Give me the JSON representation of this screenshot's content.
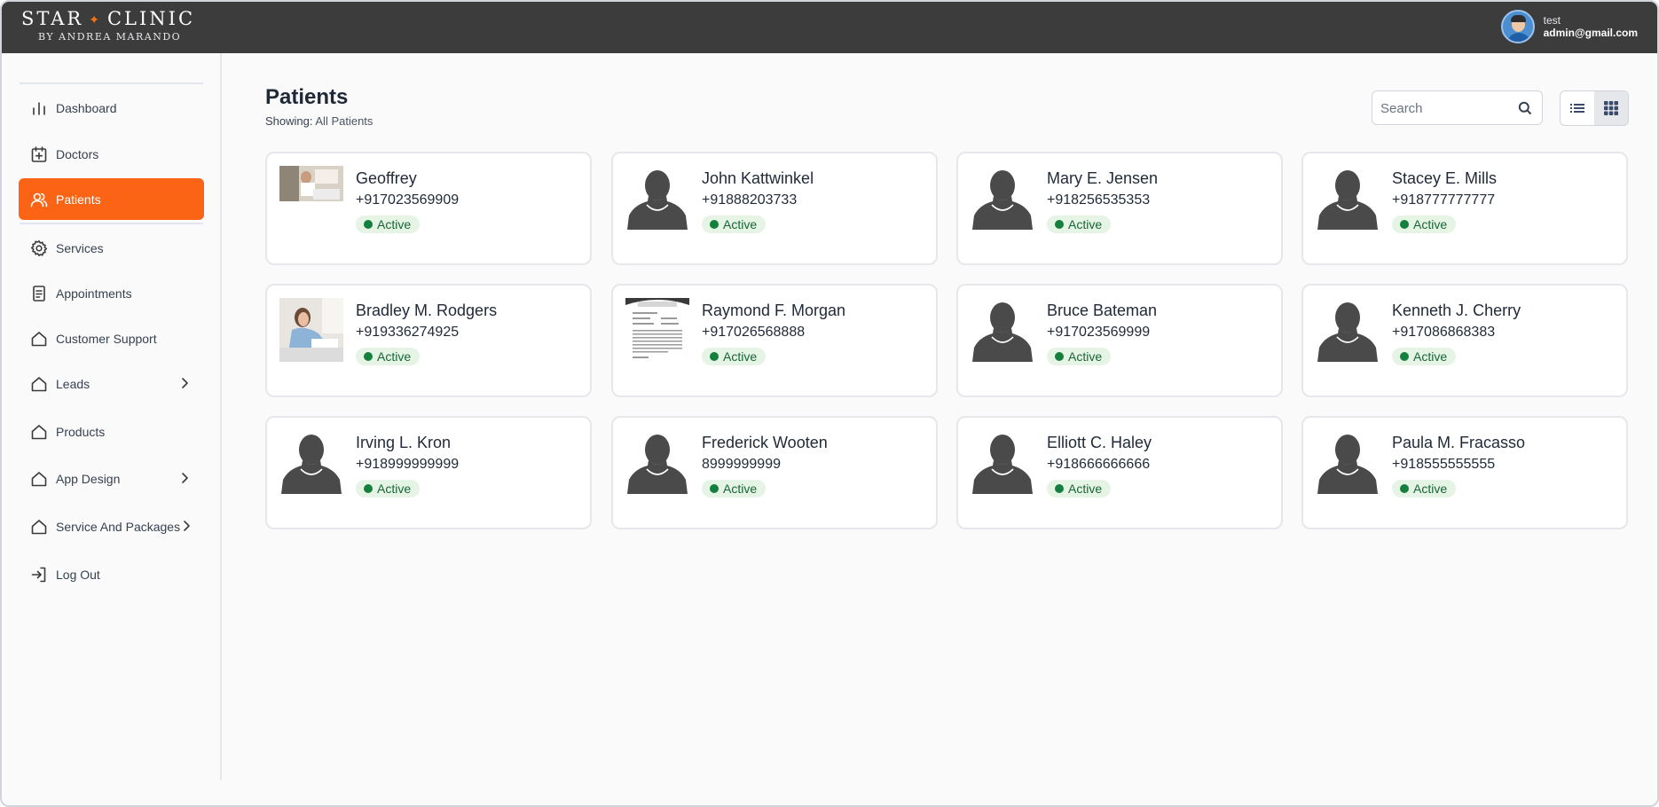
{
  "brand": {
    "name_left": "STAR",
    "name_right": "CLINIC",
    "sub": "BY ANDREA MARANDO",
    "accent": "#fa6414"
  },
  "user": {
    "name": "test",
    "email": "admin@gmail.com"
  },
  "sidebar": {
    "items": [
      {
        "label": "Dashboard",
        "icon": "bar-chart-icon"
      },
      {
        "label": "Doctors",
        "icon": "calendar-plus-icon"
      },
      {
        "label": "Patients",
        "icon": "users-icon",
        "active": true
      },
      {
        "label": "Services",
        "icon": "gear-icon"
      },
      {
        "label": "Appointments",
        "icon": "document-icon"
      },
      {
        "label": "Customer Support",
        "icon": "home-icon"
      },
      {
        "label": "Leads",
        "icon": "home-icon",
        "has_submenu": true
      },
      {
        "label": "Products",
        "icon": "home-icon"
      },
      {
        "label": "App Design",
        "icon": "home-icon",
        "has_submenu": true
      },
      {
        "label": "Service And Packages",
        "icon": "home-icon",
        "has_submenu": true
      },
      {
        "label": "Log Out",
        "icon": "logout-icon"
      }
    ]
  },
  "header": {
    "title": "Patients",
    "showing_label": "Showing:",
    "showing_value": "All Patients"
  },
  "search": {
    "placeholder": "Search",
    "value": ""
  },
  "view": {
    "selected": "grid",
    "options": [
      "list",
      "grid"
    ]
  },
  "patients": [
    {
      "name": "Geoffrey",
      "phone": "+917023569909",
      "status": "Active",
      "photo": "photo-room"
    },
    {
      "name": "John Kattwinkel",
      "phone": "+91888203733",
      "status": "Active",
      "photo": "silhouette"
    },
    {
      "name": "Mary E. Jensen",
      "phone": "+918256535353",
      "status": "Active",
      "photo": "silhouette"
    },
    {
      "name": "Stacey E. Mills",
      "phone": "+918777777777",
      "status": "Active",
      "photo": "silhouette"
    },
    {
      "name": "Bradley M. Rodgers",
      "phone": "+919336274925",
      "status": "Active",
      "photo": "photo-bed"
    },
    {
      "name": "Raymond F. Morgan",
      "phone": "+917026568888",
      "status": "Active",
      "photo": "photo-document"
    },
    {
      "name": "Bruce Bateman",
      "phone": "+917023569999",
      "status": "Active",
      "photo": "silhouette"
    },
    {
      "name": "Kenneth J. Cherry",
      "phone": "+917086868383",
      "status": "Active",
      "photo": "silhouette"
    },
    {
      "name": "Irving L. Kron",
      "phone": "+918999999999",
      "status": "Active",
      "photo": "silhouette"
    },
    {
      "name": "Frederick Wooten",
      "phone": "8999999999",
      "status": "Active",
      "photo": "silhouette"
    },
    {
      "name": "Elliott C. Haley",
      "phone": "+918666666666",
      "status": "Active",
      "photo": "silhouette"
    },
    {
      "name": "Paula M. Fracasso",
      "phone": "+918555555555",
      "status": "Active",
      "photo": "silhouette"
    }
  ]
}
